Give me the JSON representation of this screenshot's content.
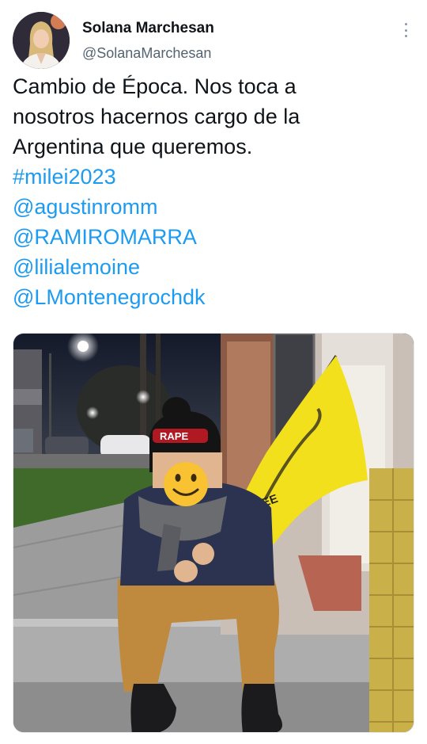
{
  "author": {
    "name": "Solana Marchesan",
    "handle": "@SolanaMarchesan",
    "avatar_icon": "profile-photo"
  },
  "tweet": {
    "text_lines": [
      "Cambio de Época. Nos toca a",
      "nosotros hacernos cargo de la",
      "Argentina que queremos."
    ],
    "hashtag": "#milei2023",
    "mentions": [
      "@agustinromm",
      "@RAMIROMARRA",
      "@lilialemoine",
      "@LMontenegrochdk"
    ]
  },
  "media": {
    "cap_text": "RAPE",
    "flag_text": "DCREE",
    "face_icon": "smiley-face-emoji",
    "flag_color": "#f2e01c"
  },
  "menu_icon": "more-options-icon",
  "colors": {
    "link": "#1d9bf0",
    "text": "#0f1419",
    "secondary": "#536471"
  }
}
